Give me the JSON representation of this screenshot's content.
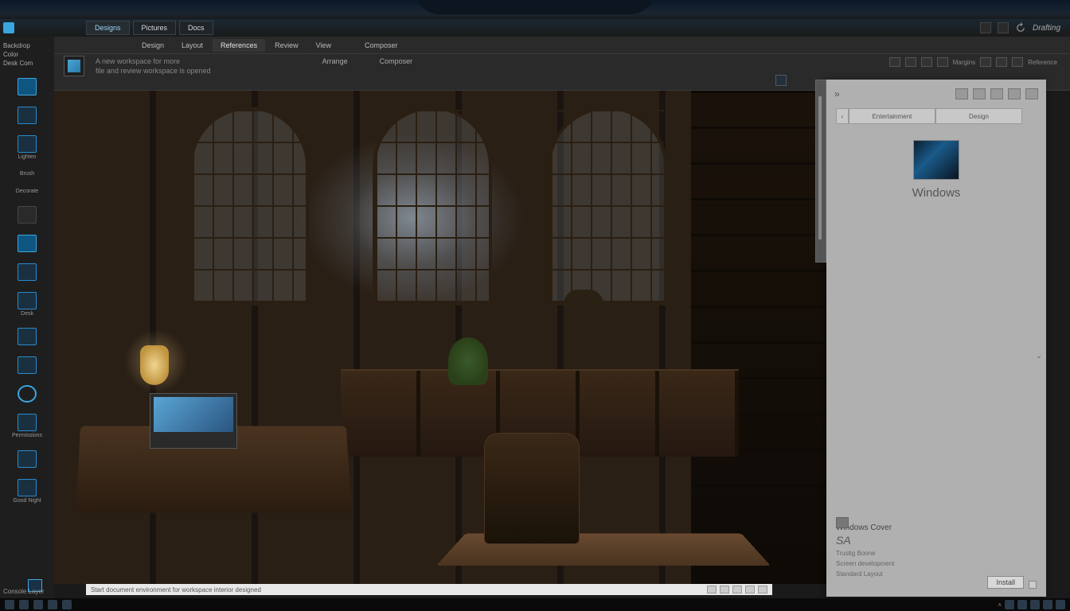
{
  "titlebar": {
    "tabs": [
      "Pictures",
      "Docs"
    ],
    "highlight_tab": "Designs",
    "right_label": "Drafting"
  },
  "ribbon": {
    "tabs": [
      "Design",
      "Layout",
      "References",
      "Review",
      "View",
      "Composer"
    ],
    "sub_text_1": "A new workspace for more",
    "sub_text_2": "file and review workspace is opened",
    "label_section": "Arrange",
    "label_right": "Composer"
  },
  "sidebar": {
    "text_top_1": "Backdrop",
    "text_top_2": "Color",
    "text_top_3": "Desk Com",
    "items": [
      {
        "label": ""
      },
      {
        "label": ""
      },
      {
        "label": "Lighten"
      },
      {
        "label": "Brush"
      },
      {
        "label": "Decorate"
      },
      {
        "label": ""
      },
      {
        "label": ""
      },
      {
        "label": ""
      },
      {
        "label": "Desk"
      },
      {
        "label": ""
      },
      {
        "label": ""
      },
      {
        "label": ""
      },
      {
        "label": ""
      },
      {
        "label": "Permissions"
      },
      {
        "label": ""
      },
      {
        "label": ""
      },
      {
        "label": "Good Night"
      }
    ],
    "bottom_label": "Console Layer"
  },
  "right_panel": {
    "tabs": [
      "Entertainment",
      "Design"
    ],
    "os_label": "Windows",
    "section_title": "Windows Cover",
    "signature": "SA",
    "sub_line1": "Trustig Boone",
    "sub_line2": "Screen development",
    "sub_line3": "Standard Layout",
    "action_label": "Install"
  },
  "statusbar": {
    "text": "Start  document environment  for workspace interior designed"
  },
  "left_status_label": "Console Layer",
  "colors": {
    "accent": "#3ba5e0",
    "bg_dark": "#1e1e1e",
    "panel_gray": "#b0b0b0"
  }
}
